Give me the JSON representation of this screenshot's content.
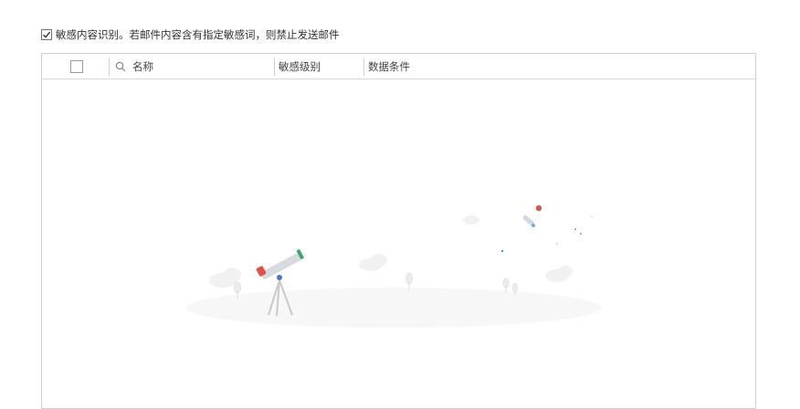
{
  "option": {
    "checked": true,
    "label": "敏感内容识别。若邮件内容含有指定敏感词，则禁止发送邮件"
  },
  "table": {
    "columns": {
      "name": "名称",
      "level": "敏感级别",
      "condition": "数据条件"
    },
    "rows": []
  },
  "icons": {
    "search": "search-icon",
    "checkmark": "checkmark-icon",
    "empty_state": "telescope-rocket-illustration"
  },
  "colors": {
    "border": "#cfcfcf",
    "text": "#333333",
    "rocket_dot_red": "#e2504c",
    "telescope_accent_green": "#3ba86b"
  }
}
